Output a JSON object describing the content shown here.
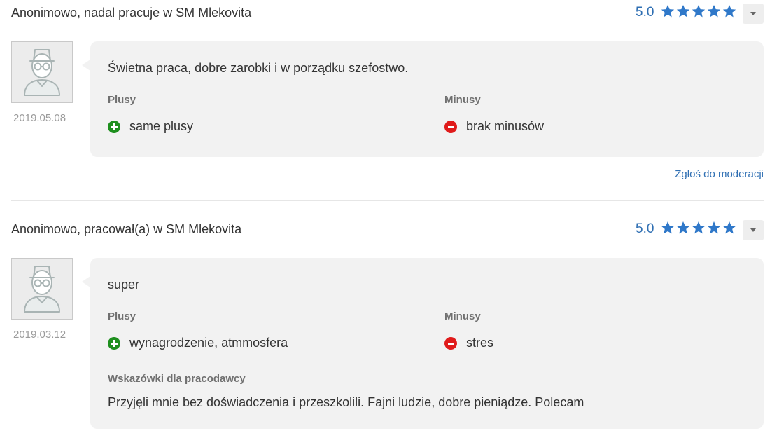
{
  "colors": {
    "accent": "#2f6fb3",
    "star": "#2f78c9",
    "plus": "#1e8f1e",
    "minus": "#e01b1b",
    "bubble_bg": "#f2f2f2"
  },
  "reviews": [
    {
      "title": "Anonimowo, nadal pracuje w SM Mlekovita",
      "score": "5.0",
      "stars": 5,
      "date": "2019.05.08",
      "summary": "Świetna praca, dobre zarobki i w porządku szefostwo.",
      "plus_label": "Plusy",
      "minus_label": "Minusy",
      "plus": "same plusy",
      "minus": "brak minusów",
      "report": "Zgłoś do moderacji"
    },
    {
      "title": "Anonimowo, pracował(a) w SM Mlekovita",
      "score": "5.0",
      "stars": 5,
      "date": "2019.03.12",
      "summary": "super",
      "plus_label": "Plusy",
      "minus_label": "Minusy",
      "plus": "wynagrodzenie, atmmosfera",
      "minus": "stres",
      "tips_label": "Wskazówki dla pracodawcy",
      "tips": "Przyjęli mnie bez doświadczenia i przeszkolili. Fajni ludzie, dobre pieniądze. Polecam"
    }
  ]
}
